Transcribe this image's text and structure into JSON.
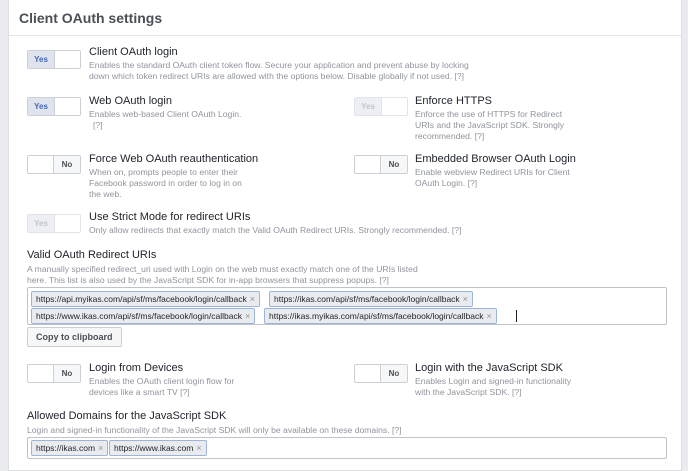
{
  "header": {
    "title": "Client OAuth settings"
  },
  "help_mark": "[?]",
  "options": {
    "client_oauth_login": {
      "toggle": "Yes",
      "title": "Client OAuth login",
      "desc_line1": "Enables the standard OAuth client token flow. Secure your application and prevent abuse by locking",
      "desc_line2": "down which token redirect URIs are allowed with the options below. Disable globally if not used."
    },
    "web_oauth_login": {
      "toggle": "Yes",
      "title": "Web OAuth login",
      "desc_line1": "Enables web-based Client OAuth Login."
    },
    "enforce_https": {
      "toggle": "Yes",
      "title": "Enforce HTTPS",
      "desc_line1": "Enforce the use of HTTPS for Redirect",
      "desc_line2": "URIs and the JavaScript SDK. Strongly",
      "desc_line3": "recommended."
    },
    "force_reauth": {
      "toggle": "No",
      "title": "Force Web OAuth reauthentication",
      "desc_line1": "When on, prompts people to enter their",
      "desc_line2": "Facebook password in order to log in on",
      "desc_line3": "the web."
    },
    "embedded_browser": {
      "toggle": "No",
      "title": "Embedded Browser OAuth Login",
      "desc_line1": "Enable webview Redirect URIs for Client",
      "desc_line2": "OAuth Login."
    },
    "strict_mode": {
      "toggle": "Yes",
      "title": "Use Strict Mode for redirect URIs",
      "desc_line1": "Only allow redirects that exactly match the Valid OAuth Redirect URIs. Strongly recommended."
    },
    "login_from_devices": {
      "toggle": "No",
      "title": "Login from Devices",
      "desc_line1": "Enables the OAuth client login flow for",
      "desc_line2": "devices like a smart TV"
    },
    "login_js_sdk": {
      "toggle": "No",
      "title": "Login with the JavaScript SDK",
      "desc_line1": "Enables Login and signed-in functionality",
      "desc_line2": "with the JavaScript SDK."
    }
  },
  "redirect_uris": {
    "label": "Valid OAuth Redirect URIs",
    "desc_line1": "A manually specified redirect_uri used with Login on the web must exactly match one of the URIs listed",
    "desc_line2": "here. This list is also used by the JavaScript SDK for in-app browsers that suppress popups.",
    "tokens": [
      "https://api.myikas.com/api/sf/ms/facebook/login/callback",
      "https://ikas.com/api/sf/ms/facebook/login/callback",
      "https://www.ikas.com/api/sf/ms/facebook/login/callback",
      "https://ikas.myikas.com/api/sf/ms/facebook/login/callback"
    ],
    "copy_button": "Copy to clipboard"
  },
  "allowed_domains": {
    "label": "Allowed Domains for the JavaScript SDK",
    "desc_line1": "Login and signed-in functionality of the JavaScript SDK will only be available on these domains.",
    "tokens": [
      "https://ikas.com",
      "https://www.ikas.com"
    ]
  },
  "colors": {
    "accent": "#4267b2",
    "token_border": "#9cb4d8",
    "muted_text": "#90949c"
  }
}
